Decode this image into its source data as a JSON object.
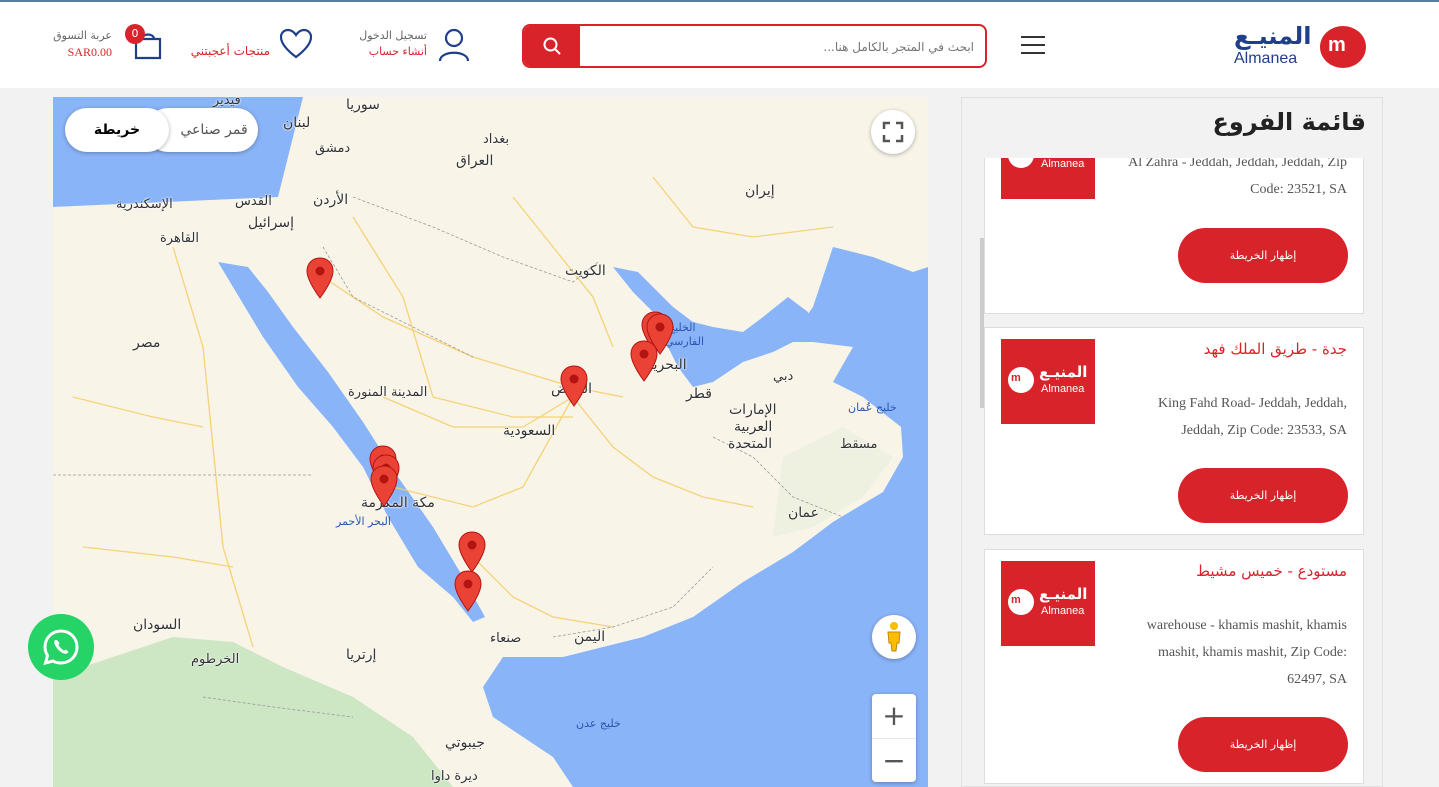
{
  "header": {
    "logo_ar": "المنيـع",
    "logo_en": "Almanea",
    "search_placeholder": "ابحث في المتجر بالكامل هنا...",
    "login_label": "تسجيل الدخول",
    "register_label": "أنشاء حساب",
    "wishlist_label": "منتجات أعجبتني",
    "cart_label": "عربة التسوق",
    "cart_total": "SAR0.00",
    "cart_count": "0",
    "icons": [
      "menu-icon",
      "search-icon",
      "user-icon",
      "heart-icon",
      "cart-icon"
    ]
  },
  "map": {
    "map_type_map": "خريطة",
    "map_type_satellite": "قمر صناعي",
    "zoom_in": "+",
    "zoom_out": "−",
    "labels": {
      "lebanon": "لبنان",
      "syria": "سوريا",
      "damascus": "دمشق",
      "baghdad": "بغداد",
      "iraq": "العراق",
      "iran": "إيران",
      "jordan": "الأردن",
      "quds": "القدس",
      "israel": "إسرائيل",
      "alexandria": "الإسكندرية",
      "cairo": "القاهرة",
      "egypt": "مصر",
      "kuwait": "الكويت",
      "gulf_1": "الخليج",
      "gulf_2": "الفارسي",
      "bahrain": "البحرين",
      "qatar": "قطر",
      "dubai": "دبي",
      "uae_1": "الإمارات",
      "uae_2": "العربية",
      "uae_3": "المتحدة",
      "oman_gulf": "خليج عُمان",
      "muscat": "مسقط",
      "oman": "عمان",
      "madinah": "المدينة المنورة",
      "riyadh": "الرياض",
      "saudi": "السعودية",
      "makkah": "مكة المكرمة",
      "red_sea": "البحر الأحمر",
      "sudan": "السودان",
      "khartoum": "الخرطوم",
      "eritrea": "إرتريا",
      "yemen": "اليمن",
      "sanaa": "صنعاء",
      "aden_gulf": "خليج عدن",
      "djibouti": "جيبوتي",
      "dire_dawa": "ديرة داوا",
      "fadeid": "فيدير"
    }
  },
  "branches": {
    "title": "قائمة الفروع",
    "show_map_label": "إظهار الخريطة",
    "items": [
      {
        "name": "",
        "addr": "Al Zahra - Jeddah, Jeddah, Jeddah, Zip Code: 23521, SA"
      },
      {
        "name": "جدة - طريق الملك فهد",
        "addr": "King Fahd Road- Jeddah, Jeddah, Jeddah, Zip Code: 23533, SA"
      },
      {
        "name": "مستودع - خميس مشيط",
        "addr": "warehouse - khamis mashit, khamis mashit, khamis mashit, Zip Code: 62497, SA"
      }
    ]
  },
  "colors": {
    "brand_red": "#d8232a",
    "brand_blue": "#1f3f8a",
    "whatsapp": "#25d366",
    "sea": "#8ab4f8",
    "land": "#f8f4e8"
  }
}
